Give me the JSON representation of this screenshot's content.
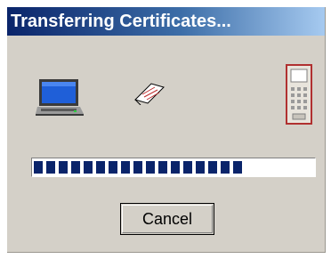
{
  "window": {
    "title": "Transferring Certificates...",
    "title_colors": [
      "#0a246a",
      "#a6caf0"
    ]
  },
  "icons": {
    "source": "laptop-computer-icon",
    "transfer": "flying-paper-icon",
    "destination": "mobile-device-icon"
  },
  "progress": {
    "fraction": 0.77,
    "segment_color": "#0a246a"
  },
  "buttons": {
    "cancel_label": "Cancel"
  }
}
